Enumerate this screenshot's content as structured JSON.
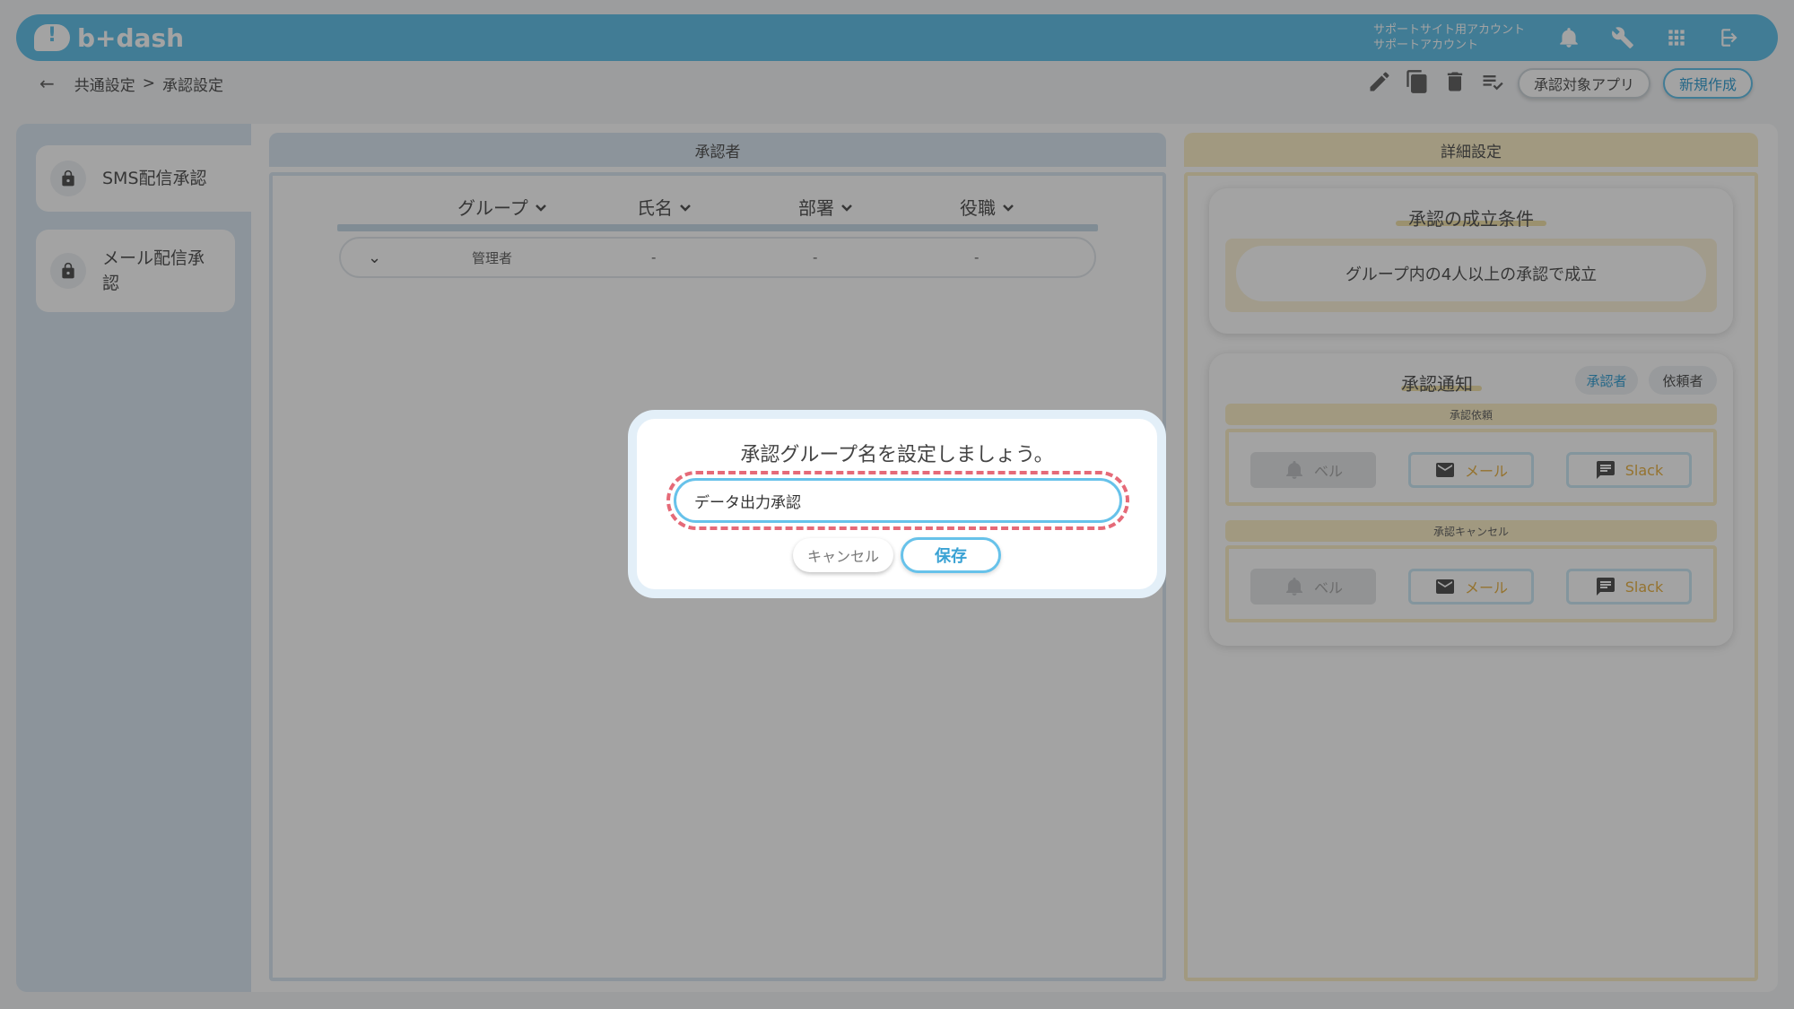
{
  "header": {
    "logo_text": "b+dash",
    "account_line1": "サポートサイト用アカウント",
    "account_line2": "サポートアカウント"
  },
  "breadcrumb": {
    "parent": "共通設定",
    "separator": ">",
    "current": "承認設定"
  },
  "toolbar": {
    "target_app_label": "承認対象アプリ",
    "new_label": "新規作成"
  },
  "sidebar": {
    "items": [
      {
        "label": "SMS配信承認"
      },
      {
        "label": "メール配信承認"
      }
    ]
  },
  "approvers_panel": {
    "title": "承認者",
    "columns": [
      "グループ",
      "氏名",
      "部署",
      "役職"
    ],
    "rows": [
      {
        "group": "管理者",
        "name": "-",
        "department": "-",
        "position": "-"
      }
    ]
  },
  "detail_panel": {
    "title": "詳細設定",
    "condition_title": "承認の成立条件",
    "condition_text": "グループ内の4人以上の承認で成立",
    "notify_title": "承認通知",
    "tab_approver": "承認者",
    "tab_requester": "依頼者",
    "request_section": "承認依頼",
    "cancel_section": "承認キャンセル",
    "bell_label": "ベル",
    "mail_label": "メール",
    "slack_label": "Slack"
  },
  "modal": {
    "title": "承認グループ名を設定しましょう。",
    "input_value": "データ出力承認",
    "cancel_label": "キャンセル",
    "save_label": "保存"
  },
  "colors": {
    "brand_blue": "#67c2ea",
    "highlight_dash": "#e56a78",
    "detail_accent": "#f2e3ad"
  }
}
